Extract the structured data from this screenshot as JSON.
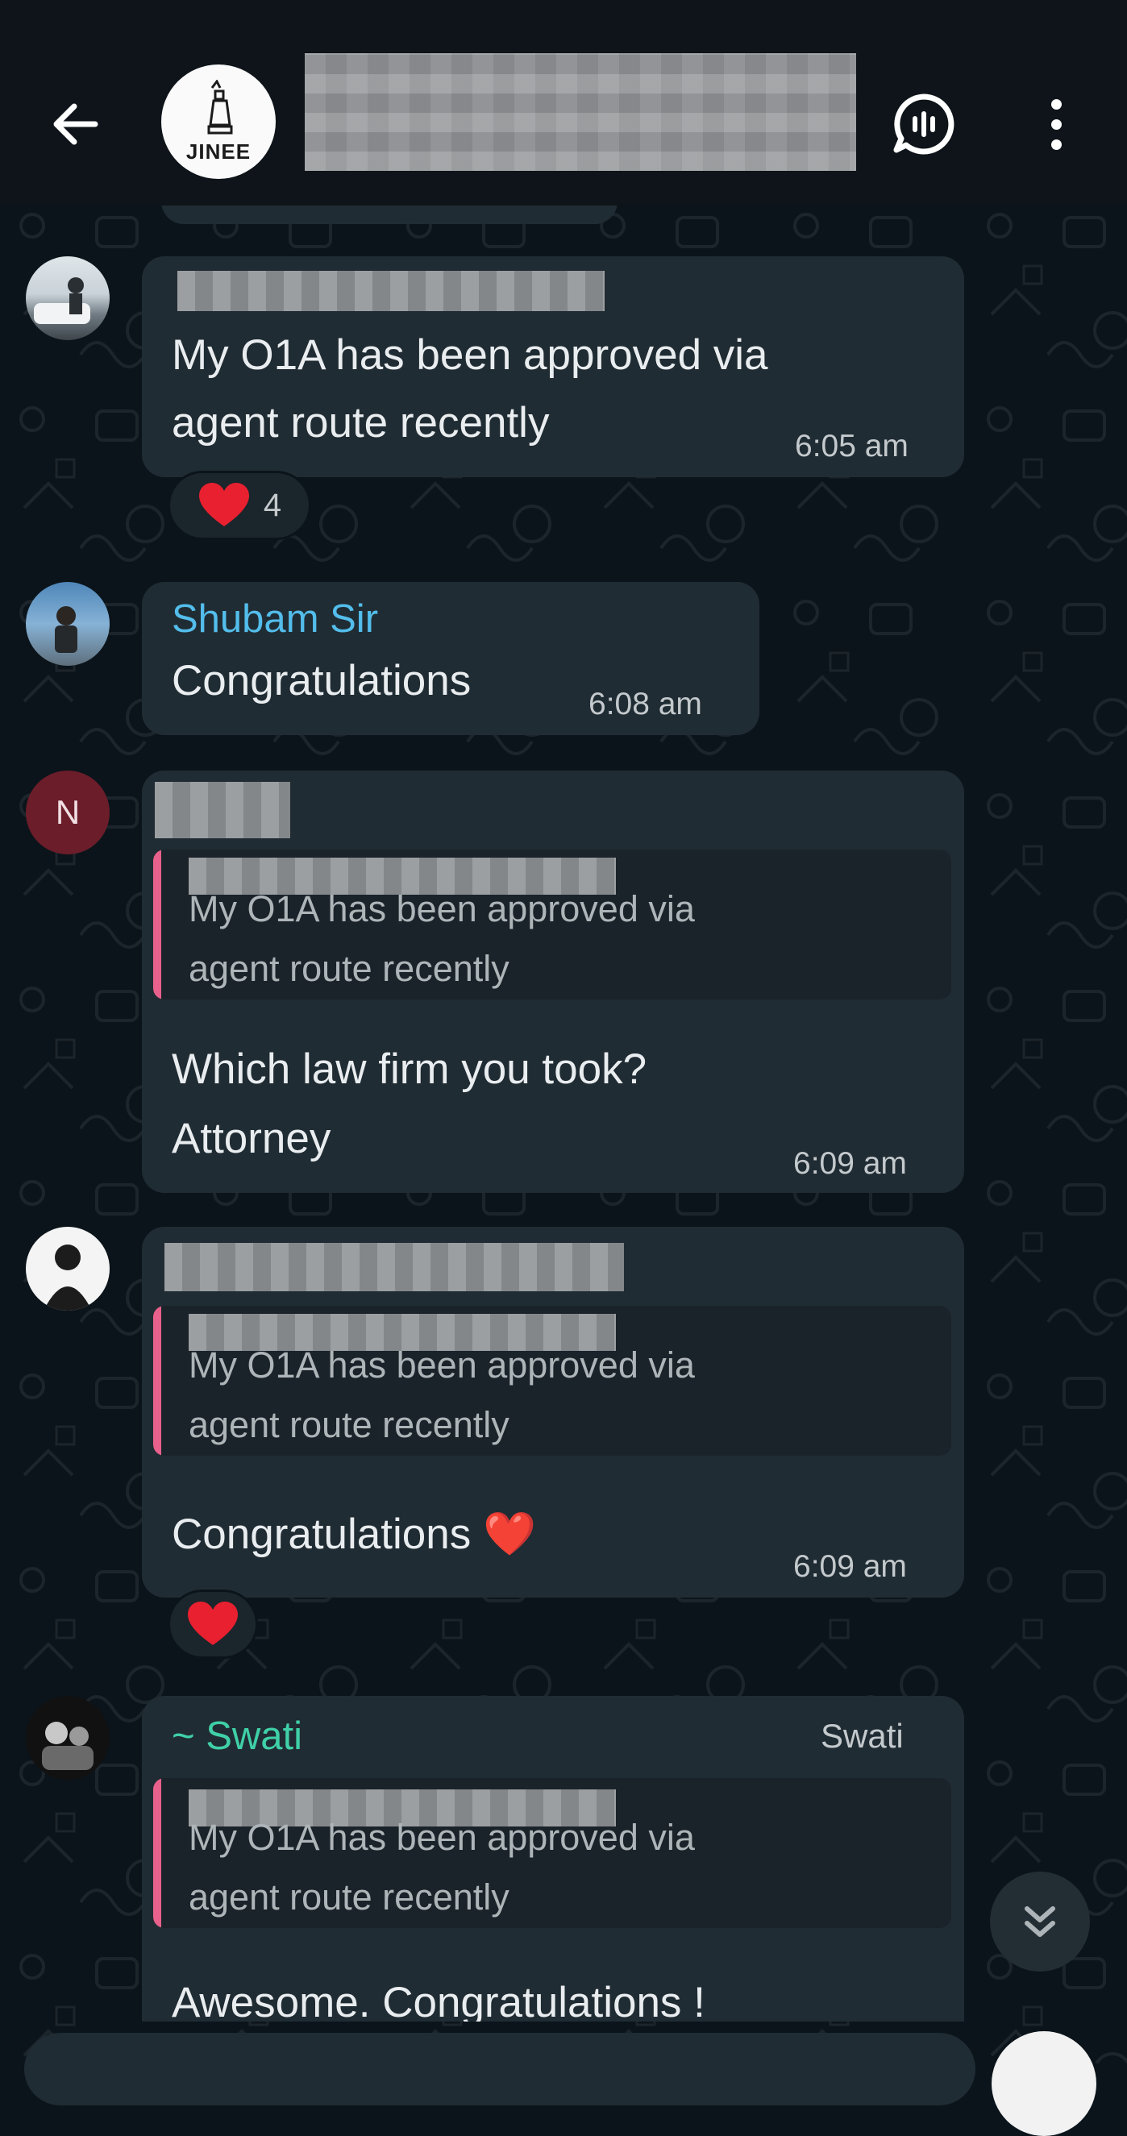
{
  "header": {
    "group_logo_text": "JINEE",
    "group_name_redacted": "",
    "icons": {
      "back": "arrow-left-icon",
      "voice_chat": "voice-chat-icon",
      "menu": "more-vert-icon"
    }
  },
  "messages": [
    {
      "sender_redacted": true,
      "text_line1": "My O1A has been approved via",
      "text_line2": "agent route recently",
      "time": "6:05 am",
      "reaction": {
        "emoji": "❤️",
        "count": "4"
      }
    },
    {
      "sender": "Shubam Sir",
      "sender_color": "#53bdeb",
      "text": "Congratulations",
      "time": "6:08 am"
    },
    {
      "avatar_letter": "N",
      "sender_redacted": true,
      "quote_line1": "My O1A has been approved via",
      "quote_line2": "agent route recently",
      "text_line1": "Which law firm you took?",
      "text_line2": "Attorney",
      "time": "6:09 am"
    },
    {
      "sender_redacted": true,
      "quote_line1": "My O1A has been approved via",
      "quote_line2": "agent route recently",
      "text": "Congratulations ❤️",
      "time": "6:09 am",
      "reaction": {
        "emoji": "❤️"
      }
    },
    {
      "sender": "~ Swati",
      "sender_color": "#3fd0a7",
      "sender_phone_name": "Swati",
      "quote_line1": "My O1A has been approved via",
      "quote_line2": "agent route recently",
      "text": "Awesome. Congratulations !"
    }
  ],
  "scroll_button_icon": "double-chevron-down-icon"
}
